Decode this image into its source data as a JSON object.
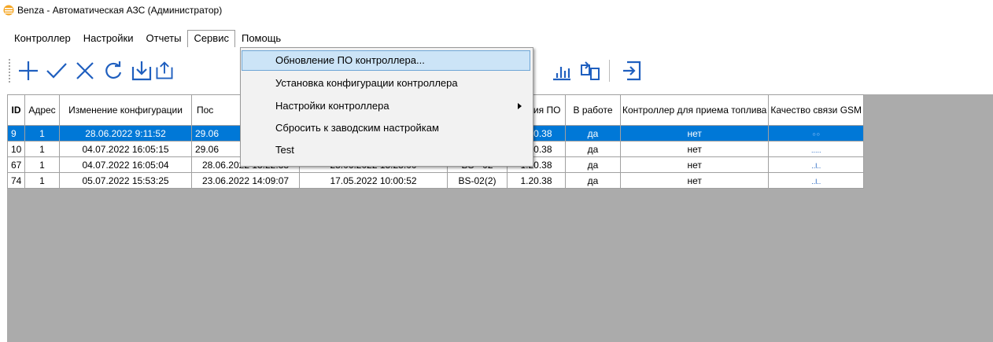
{
  "window": {
    "title": "Benza - Автоматическая АЗС (Администратор)"
  },
  "menubar": {
    "items": [
      {
        "label": "Контроллер"
      },
      {
        "label": "Настройки"
      },
      {
        "label": "Отчеты"
      },
      {
        "label": "Сервис"
      },
      {
        "label": "Помощь"
      }
    ]
  },
  "service_menu": {
    "items": [
      {
        "label": "Обновление ПО контроллера..."
      },
      {
        "label": "Установка конфигурации контроллера"
      },
      {
        "label": "Настройки контроллера"
      },
      {
        "label": "Сбросить к заводским настройкам"
      },
      {
        "label": "Test"
      }
    ]
  },
  "toolbar": {
    "icons": [
      "plus-icon",
      "check-icon",
      "cross-icon",
      "refresh-icon",
      "download-icon",
      "upload-icon",
      "chart-icon",
      "transfer-icon",
      "exit-icon"
    ]
  },
  "grid": {
    "headers": {
      "id": "ID",
      "address": "Адрес",
      "config_change": "Изменение конфигурации",
      "last_col": "Пос",
      "version": "Версия ПО",
      "working": "В работе",
      "fuel_controller": "Контроллер для приема топлива",
      "gsm": "Качество связи GSM"
    },
    "rows": [
      {
        "id": "9",
        "address": "1",
        "config_change": "28.06.2022 9:11:52",
        "c4": "29.06",
        "c5": "",
        "c6": "",
        "version": "1.20.38",
        "working": "да",
        "fuel": "нет",
        "gsm": "⸰⸰",
        "selected": true
      },
      {
        "id": "10",
        "address": "1",
        "config_change": "04.07.2022 16:05:15",
        "c4": "29.06",
        "c5": "",
        "c6": "",
        "version": "1.20.38",
        "working": "да",
        "fuel": "нет",
        "gsm": "....."
      },
      {
        "id": "67",
        "address": "1",
        "config_change": "04.07.2022 16:05:04",
        "c4": "28.06.2022 13:22:38",
        "c5": "28.06.2022 13:28:00",
        "c6": "BS - 02",
        "version": "1.20.38",
        "working": "да",
        "fuel": "нет",
        "gsm": "..l.."
      },
      {
        "id": "74",
        "address": "1",
        "config_change": "05.07.2022 15:53:25",
        "c4": "23.06.2022 14:09:07",
        "c5": "17.05.2022 10:00:52",
        "c6": "BS-02(2)",
        "version": "1.20.38",
        "working": "да",
        "fuel": "нет",
        "gsm": "..l.."
      }
    ]
  },
  "colors": {
    "selection": "#0078d7",
    "menu_hover": "#cce4f7",
    "grid_bg": "#ababab",
    "icon": "#1f5fbf"
  }
}
